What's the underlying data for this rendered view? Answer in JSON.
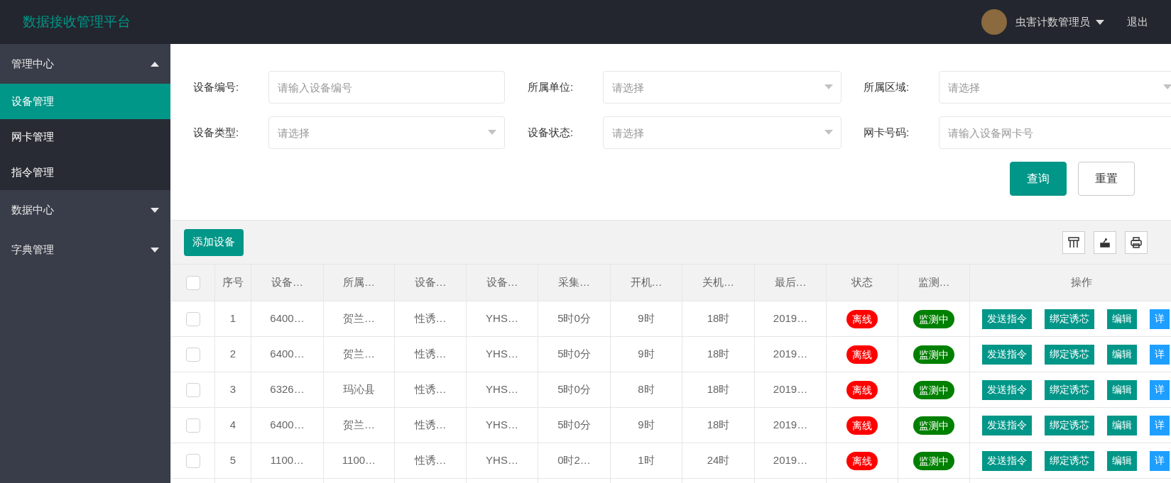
{
  "header": {
    "title": "数据接收管理平台",
    "user": "虫害计数管理员",
    "logout": "退出"
  },
  "sidebar": {
    "groups": [
      {
        "label": "管理中心",
        "expanded": true,
        "children": [
          {
            "label": "设备管理",
            "selected": true
          },
          {
            "label": "网卡管理",
            "selected": false
          },
          {
            "label": "指令管理",
            "selected": false
          }
        ]
      },
      {
        "label": "数据中心",
        "expanded": false
      },
      {
        "label": "字典管理",
        "expanded": false
      }
    ]
  },
  "filters": [
    {
      "label": "设备编号:",
      "kind": "input",
      "placeholder": "请输入设备编号"
    },
    {
      "label": "所属单位:",
      "kind": "select",
      "placeholder": "请选择"
    },
    {
      "label": "所属区域:",
      "kind": "select",
      "placeholder": "请选择"
    },
    {
      "label": "设备类型:",
      "kind": "select",
      "placeholder": "请选择"
    },
    {
      "label": "设备状态:",
      "kind": "select",
      "placeholder": "请选择"
    },
    {
      "label": "网卡号码:",
      "kind": "input",
      "placeholder": "请输入设备网卡号"
    }
  ],
  "filter_buttons": [
    {
      "label": "查询",
      "kind": "primary"
    },
    {
      "label": "重置",
      "kind": "plain"
    }
  ],
  "toolbar": {
    "add_button": "添加设备"
  },
  "table": {
    "columns": [
      "序号",
      "设备…",
      "所属…",
      "设备…",
      "设备…",
      "采集…",
      "开机…",
      "关机…",
      "最后…",
      "状态",
      "监测…",
      "操作"
    ],
    "header_checked": false,
    "rows": [
      {
        "checked": false,
        "cells": [
          "1",
          "6400…",
          "贺兰…",
          "性诱…",
          "YHS…",
          "5时0分",
          "9时",
          "18时",
          "2019…"
        ],
        "status": {
          "text": "离线",
          "color": "#ff0000"
        },
        "monitor": {
          "text": "监测中",
          "color": "#008000"
        },
        "actions": [
          {
            "label": "发送指令",
            "kind": "primary"
          },
          {
            "label": "绑定诱芯",
            "kind": "primary"
          },
          {
            "label": "编辑",
            "kind": "primary"
          },
          {
            "label": "详",
            "kind": "info"
          }
        ]
      },
      {
        "checked": false,
        "cells": [
          "2",
          "6400…",
          "贺兰…",
          "性诱…",
          "YHS…",
          "5时0分",
          "9时",
          "18时",
          "2019…"
        ],
        "status": {
          "text": "离线",
          "color": "#ff0000"
        },
        "monitor": {
          "text": "监测中",
          "color": "#008000"
        },
        "actions": [
          {
            "label": "发送指令",
            "kind": "primary"
          },
          {
            "label": "绑定诱芯",
            "kind": "primary"
          },
          {
            "label": "编辑",
            "kind": "primary"
          },
          {
            "label": "详",
            "kind": "info"
          }
        ]
      },
      {
        "checked": false,
        "cells": [
          "3",
          "6326…",
          "玛沁县",
          "性诱…",
          "YHS…",
          "5时0分",
          "8时",
          "18时",
          "2019…"
        ],
        "status": {
          "text": "离线",
          "color": "#ff0000"
        },
        "monitor": {
          "text": "监测中",
          "color": "#008000"
        },
        "actions": [
          {
            "label": "发送指令",
            "kind": "primary"
          },
          {
            "label": "绑定诱芯",
            "kind": "primary"
          },
          {
            "label": "编辑",
            "kind": "primary"
          },
          {
            "label": "详",
            "kind": "info"
          }
        ]
      },
      {
        "checked": false,
        "cells": [
          "4",
          "6400…",
          "贺兰…",
          "性诱…",
          "YHS…",
          "5时0分",
          "9时",
          "18时",
          "2019…"
        ],
        "status": {
          "text": "离线",
          "color": "#ff0000"
        },
        "monitor": {
          "text": "监测中",
          "color": "#008000"
        },
        "actions": [
          {
            "label": "发送指令",
            "kind": "primary"
          },
          {
            "label": "绑定诱芯",
            "kind": "primary"
          },
          {
            "label": "编辑",
            "kind": "primary"
          },
          {
            "label": "详",
            "kind": "info"
          }
        ]
      },
      {
        "checked": false,
        "cells": [
          "5",
          "1100…",
          "1100…",
          "性诱…",
          "YHS…",
          "0时2…",
          "1时",
          "24时",
          "2019…"
        ],
        "status": {
          "text": "离线",
          "color": "#ff0000"
        },
        "monitor": {
          "text": "监测中",
          "color": "#008000"
        },
        "actions": [
          {
            "label": "发送指令",
            "kind": "primary"
          },
          {
            "label": "绑定诱芯",
            "kind": "primary"
          },
          {
            "label": "编辑",
            "kind": "primary"
          },
          {
            "label": "详",
            "kind": "info"
          }
        ]
      }
    ]
  }
}
